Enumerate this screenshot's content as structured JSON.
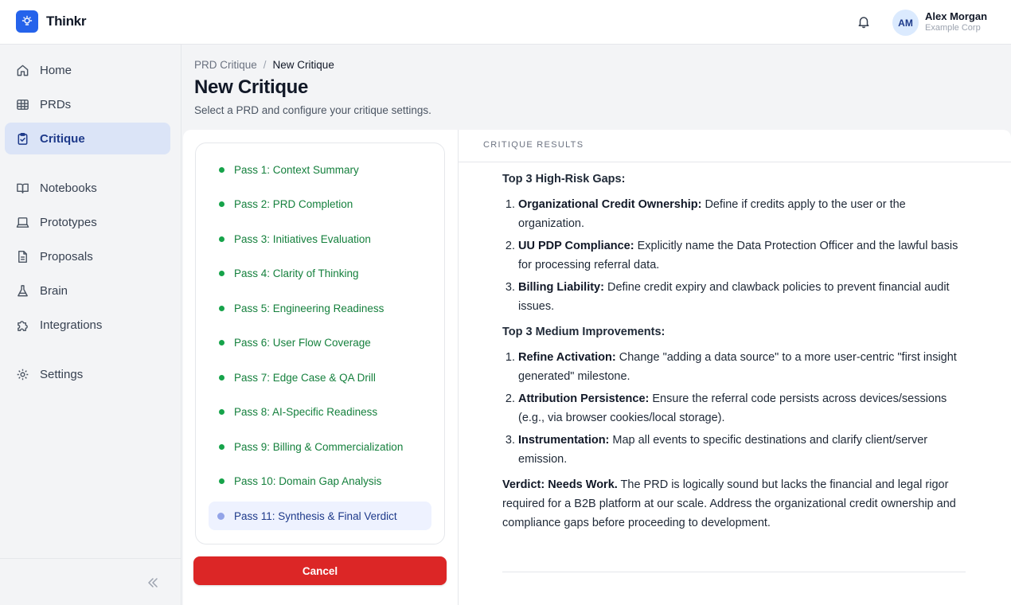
{
  "app": {
    "brand": "Thinkr",
    "logo_icon": "lightbulb-icon",
    "accent": "#2563eb"
  },
  "user": {
    "initials": "AM",
    "name": "Alex Morgan",
    "org": "Example Corp"
  },
  "sidebar": {
    "items": [
      {
        "label": "Home",
        "icon": "home-icon"
      },
      {
        "label": "PRDs",
        "icon": "table-icon"
      },
      {
        "label": "Critique",
        "icon": "clipboard-check-icon",
        "active": true
      },
      {
        "label": "Notebooks",
        "icon": "book-icon"
      },
      {
        "label": "Prototypes",
        "icon": "laptop-icon"
      },
      {
        "label": "Proposals",
        "icon": "document-icon"
      },
      {
        "label": "Brain",
        "icon": "flask-icon"
      },
      {
        "label": "Integrations",
        "icon": "puzzle-icon"
      },
      {
        "label": "Settings",
        "icon": "gear-icon"
      }
    ]
  },
  "breadcrumb": {
    "parent": "PRD Critique",
    "separator": "/",
    "current": "New Critique"
  },
  "page": {
    "title": "New Critique",
    "subtitle": "Select a PRD and configure your critique settings."
  },
  "passes": [
    {
      "label": "Pass 1: Context Summary",
      "status": "done"
    },
    {
      "label": "Pass 2: PRD Completion",
      "status": "done"
    },
    {
      "label": "Pass 3: Initiatives Evaluation",
      "status": "done"
    },
    {
      "label": "Pass 4: Clarity of Thinking",
      "status": "done"
    },
    {
      "label": "Pass 5: Engineering Readiness",
      "status": "done"
    },
    {
      "label": "Pass 6: User Flow Coverage",
      "status": "done"
    },
    {
      "label": "Pass 7: Edge Case & QA Drill",
      "status": "done"
    },
    {
      "label": "Pass 8: AI-Specific Readiness",
      "status": "done"
    },
    {
      "label": "Pass 9: Billing & Commercialization",
      "status": "done"
    },
    {
      "label": "Pass 10: Domain Gap Analysis",
      "status": "done"
    },
    {
      "label": "Pass 11: Synthesis & Final Verdict",
      "status": "active"
    }
  ],
  "cancel_label": "Cancel",
  "cancel_color": "#dc2626",
  "status_colors": {
    "done": "#16a34a",
    "active": "#93a4e8"
  },
  "results": {
    "section_label": "CRITIQUE RESULTS",
    "high_risk_heading": "Top 3 High-Risk Gaps:",
    "high_risk": [
      {
        "title": "Organizational Credit Ownership:",
        "text": " Define if credits apply to the user or the organization."
      },
      {
        "title": "UU PDP Compliance:",
        "text": " Explicitly name the Data Protection Officer and the lawful basis for processing referral data."
      },
      {
        "title": "Billing Liability:",
        "text": " Define credit expiry and clawback policies to prevent financial audit issues."
      }
    ],
    "medium_heading": "Top 3 Medium Improvements:",
    "medium": [
      {
        "title": "Refine Activation:",
        "text": " Change \"adding a data source\" to a more user-centric \"first insight generated\" milestone."
      },
      {
        "title": "Attribution Persistence:",
        "text": " Ensure the referral code persists across devices/sessions (e.g., via browser cookies/local storage)."
      },
      {
        "title": "Instrumentation:",
        "text": " Map all events to specific destinations and clarify client/server emission."
      }
    ],
    "verdict_label": "Verdict: Needs Work.",
    "verdict_text": " The PRD is logically sound but lacks the financial and legal rigor required for a B2B platform at our scale. Address the organizational credit ownership and compliance gaps before proceeding to development."
  }
}
